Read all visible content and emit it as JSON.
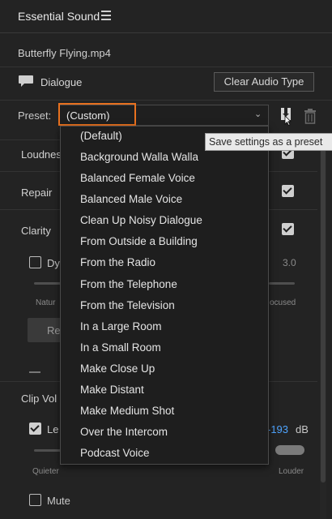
{
  "panel": {
    "title": "Essential Sound"
  },
  "clip": {
    "name": "Butterfly Flying.mp4"
  },
  "audio_type": {
    "label": "Dialogue",
    "clear_button": "Clear Audio Type"
  },
  "preset": {
    "label": "Preset:",
    "value": "(Custom)",
    "tooltip": "Save settings as a preset",
    "options": [
      "(Default)",
      "Background Walla Walla",
      "Balanced Female Voice",
      "Balanced Male Voice",
      "Clean Up Noisy Dialogue",
      "From Outside a Building",
      "From the Radio",
      "From the Telephone",
      "From the Television",
      "In a Large Room",
      "In a Small Room",
      "Make Close Up",
      "Make Distant",
      "Make Medium Shot",
      "Over the Intercom",
      "Podcast Voice"
    ]
  },
  "sections": {
    "loudness": "Loudnes",
    "repair": "Repair",
    "clarity": "Clarity",
    "clip_volume": "Clip Vol"
  },
  "clarity": {
    "dynamics_label": "Dy",
    "dynamics_value": "3.0",
    "natural_label": "Natur",
    "focused_label": "ocused",
    "reset_label": "Re"
  },
  "clip_volume": {
    "level_label": "Le",
    "level_value": "-193",
    "level_unit": "dB",
    "quieter_label": "Quieter",
    "louder_label": "Louder",
    "mute_label": "Mute"
  },
  "colors": {
    "accent": "#e8711f",
    "value_blue": "#4ea4ff",
    "background": "#232323"
  }
}
